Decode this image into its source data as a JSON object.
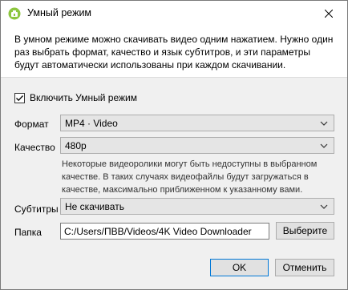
{
  "window": {
    "title": "Умный режим",
    "app_icon": "4k-downloader-icon",
    "close_icon": "close-icon"
  },
  "intro": {
    "text": "В умном режиме можно скачивать видео одним нажатием. Нужно один раз выбрать формат, качество и язык субтитров, и эти параметры будут автоматически использованы при каждом скачивании."
  },
  "smart_mode": {
    "label": "Включить Умный режим",
    "checked": true
  },
  "format": {
    "label": "Формат",
    "value": "MP4 · Video"
  },
  "quality": {
    "label": "Качество",
    "value": "480p",
    "hint": "Некоторые видеоролики могут быть недоступны в выбранном качестве. В таких случаях видеофайлы будут загружаться в качестве, максимально приближенном к указанному вами."
  },
  "subtitles": {
    "label": "Субтитры",
    "value": "Не скачивать"
  },
  "folder": {
    "label": "Папка",
    "value": "C:/Users/ПВВ/Videos/4K Video Downloader",
    "browse_label": "Выберите"
  },
  "footer": {
    "ok_label": "OK",
    "cancel_label": "Отменить"
  },
  "colors": {
    "accent": "#0078d7",
    "icon_green": "#8dc63f"
  }
}
